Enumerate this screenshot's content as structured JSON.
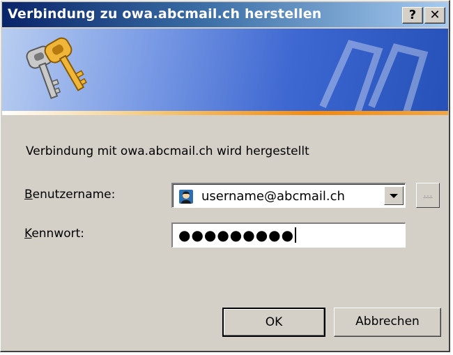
{
  "window": {
    "title": "Verbindung zu owa.abcmail.ch herstellen",
    "help_label": "?",
    "close_label": "✕"
  },
  "banner": {
    "icon": "keys-icon",
    "colors": {
      "banner_dark": "#2551b8",
      "banner_light": "#b8cdf0",
      "accent_line": "#f28a10"
    }
  },
  "dialog": {
    "connect_text": "Verbindung mit owa.abcmail.ch wird hergestellt",
    "username_label_accel": "B",
    "username_label_rest": "enutzername:",
    "username_value": "username@abcmail.ch",
    "username_icon": "user-icon",
    "browse_label": "...",
    "password_label_accel": "K",
    "password_label_rest": "ennwort:",
    "password_value": "●●●●●●●●●"
  },
  "buttons": {
    "ok": "OK",
    "cancel": "Abbrechen"
  }
}
